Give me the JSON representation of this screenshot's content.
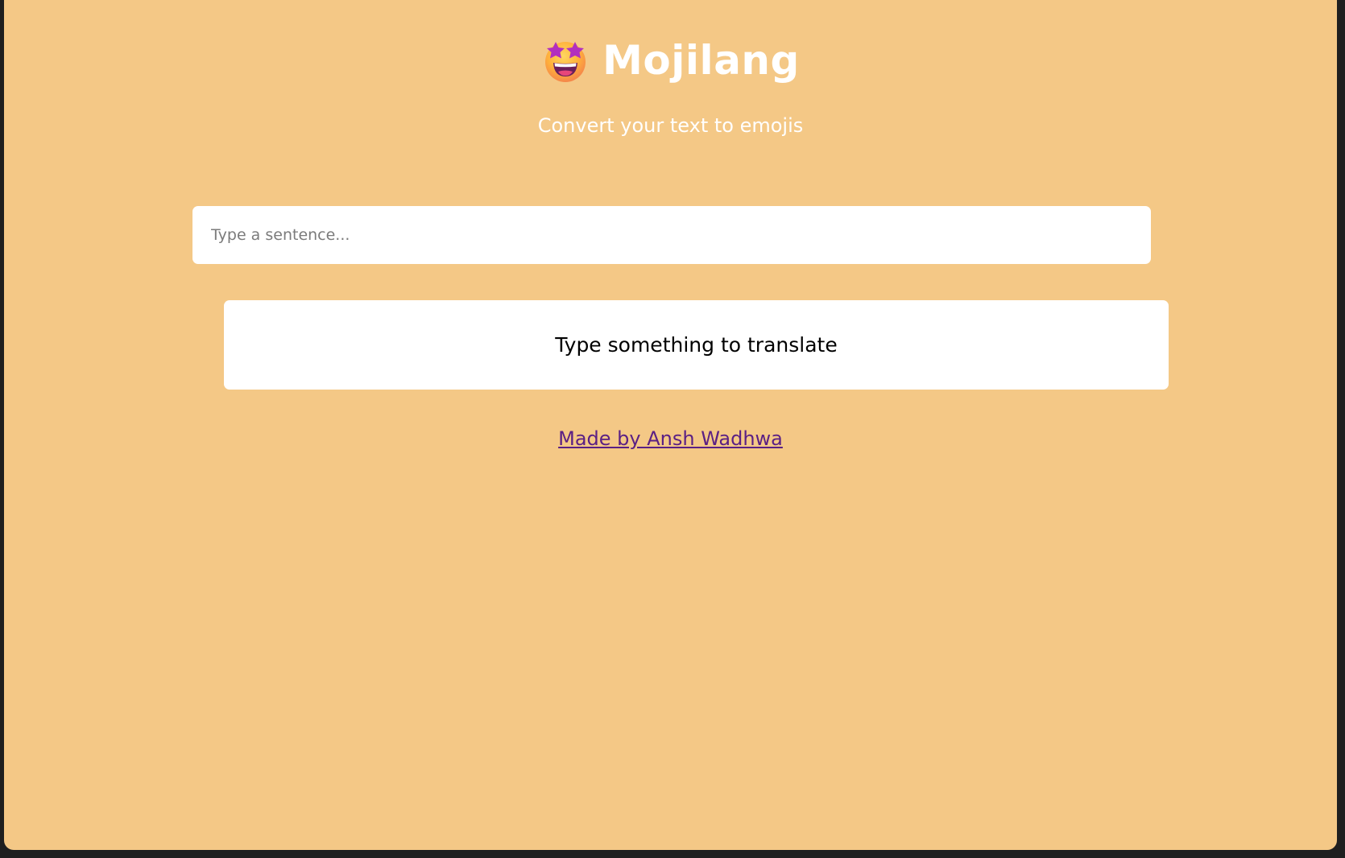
{
  "app": {
    "title": "Mojilang",
    "subtitle": "Convert your text to emojis",
    "logo_icon": "star-struck-emoji-icon"
  },
  "input": {
    "value": "",
    "placeholder": "Type a sentence..."
  },
  "output": {
    "text": "Type something to translate"
  },
  "footer": {
    "link_text": "Made by Ansh Wadhwa"
  },
  "colors": {
    "background": "#f4c886",
    "title": "#ffffff",
    "link": "#5b2084",
    "frame": "#1f1f1f"
  }
}
